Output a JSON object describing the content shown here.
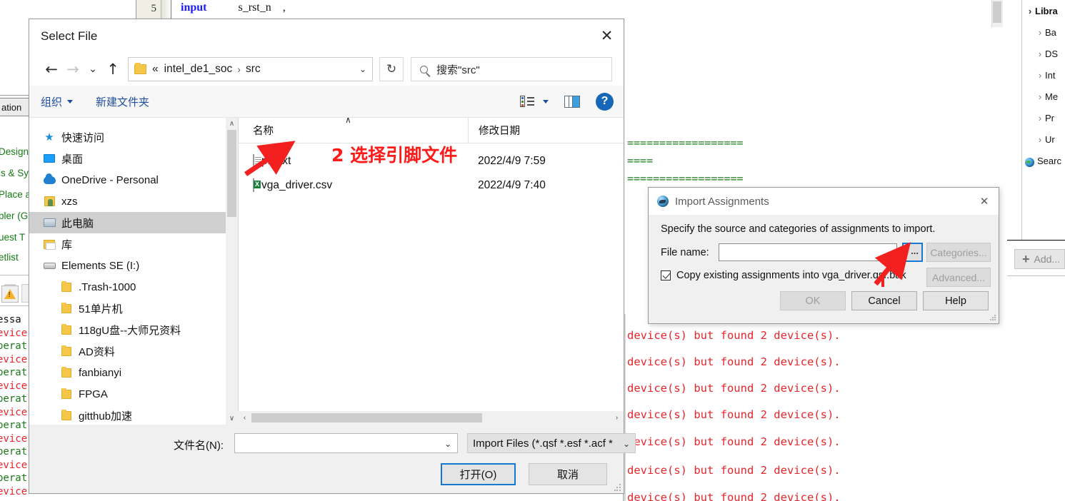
{
  "background": {
    "code_line": {
      "number": "5",
      "keyword": "input",
      "identifier": "s_rst_n",
      "comma": ","
    },
    "right_tree": {
      "root": "Libra",
      "items": [
        "Ba",
        "DS",
        "Int",
        "Me",
        "Pr",
        "Ur"
      ],
      "search_item": "Searc"
    },
    "add_button": "Add...",
    "green_lines": [
      "==================",
      "====",
      "=================="
    ],
    "error_line": "device(s) but found 2 device(s).",
    "error_lines_count": 7,
    "left_strip": {
      "tab_label": "ation",
      "green_rows": [
        "Design",
        "is & Sy",
        "Place a",
        "bler (G",
        "uest T",
        "etlist "
      ],
      "message_rows": [
        {
          "text": "essa",
          "color": "#111111"
        },
        {
          "text": "evice",
          "color": "#e8252b"
        },
        {
          "text": "perat",
          "color": "#1a7a1a"
        },
        {
          "text": "evice",
          "color": "#e8252b"
        },
        {
          "text": "perat",
          "color": "#1a7a1a"
        },
        {
          "text": "evice",
          "color": "#e8252b"
        },
        {
          "text": "perat",
          "color": "#1a7a1a"
        },
        {
          "text": "evice",
          "color": "#e8252b"
        },
        {
          "text": "perat",
          "color": "#1a7a1a"
        },
        {
          "text": "evice",
          "color": "#e8252b"
        },
        {
          "text": "perat",
          "color": "#1a7a1a"
        },
        {
          "text": "evice",
          "color": "#e8252b"
        },
        {
          "text": "perat",
          "color": "#1a7a1a"
        },
        {
          "text": "evice",
          "color": "#e8252b"
        }
      ]
    }
  },
  "select_file_dialog": {
    "title": "Select File",
    "close_label": "✕",
    "nav": {
      "back": "←",
      "forward": "→",
      "recent": "⌄",
      "up": "↑",
      "breadcrumb_prefix": "«",
      "breadcrumb_parts": [
        "intel_de1_soc",
        "src"
      ],
      "breadcrumb_sep": "›",
      "breadcrumb_chevron": "⌄",
      "refresh": "↻"
    },
    "search": {
      "placeholder": "搜索\"src\"",
      "icon": "search-icon"
    },
    "commandbar": {
      "organize": "组织",
      "new_folder": "新建文件夹",
      "view_icon": "view-list-icon",
      "view_chevron": "▼",
      "preview_icon": "preview-pane-icon",
      "help_icon": "?"
    },
    "sidebar": {
      "items": [
        {
          "label": "快速访问",
          "icon": "star-icon",
          "indent": false,
          "selected": false
        },
        {
          "label": "桌面",
          "icon": "desktop-icon",
          "indent": false,
          "selected": false
        },
        {
          "label": "OneDrive - Personal",
          "icon": "cloud-icon",
          "indent": false,
          "selected": false
        },
        {
          "label": "xzs",
          "icon": "user-folder-icon",
          "indent": false,
          "selected": false
        },
        {
          "label": "此电脑",
          "icon": "this-pc-icon",
          "indent": false,
          "selected": true
        },
        {
          "label": "库",
          "icon": "library-icon",
          "indent": false,
          "selected": false
        },
        {
          "label": "Elements SE (I:)",
          "icon": "drive-icon",
          "indent": false,
          "selected": false
        },
        {
          "label": ".Trash-1000",
          "icon": "folder-icon",
          "indent": true,
          "selected": false
        },
        {
          "label": "51单片机",
          "icon": "folder-icon",
          "indent": true,
          "selected": false
        },
        {
          "label": "118gU盘--大师兄资料",
          "icon": "folder-icon",
          "indent": true,
          "selected": false
        },
        {
          "label": "AD资料",
          "icon": "folder-icon",
          "indent": true,
          "selected": false
        },
        {
          "label": "fanbianyi",
          "icon": "folder-icon",
          "indent": true,
          "selected": false
        },
        {
          "label": "FPGA",
          "icon": "folder-icon",
          "indent": true,
          "selected": false
        },
        {
          "label": "gitthub加速",
          "icon": "folder-icon",
          "indent": true,
          "selected": false
        }
      ],
      "scroll_up": "∧",
      "scroll_down": "∨"
    },
    "filelist": {
      "columns": [
        "名称",
        "修改日期"
      ],
      "sort_indicator": "∧",
      "rows": [
        {
          "name": "pin.txt",
          "icon": "text-file-icon",
          "date": "2022/4/9 7:59"
        },
        {
          "name": "vga_driver.csv",
          "icon": "csv-file-icon",
          "date": "2022/4/9 7:40"
        }
      ],
      "hscroll_left": "‹",
      "hscroll_right": "›"
    },
    "footer": {
      "filename_label": "文件名(N):",
      "filename_value": "",
      "filename_chevron": "⌄",
      "filetype_value": "Import Files (*.qsf *.esf *.acf *",
      "filetype_chevron": "⌄",
      "open_button": "打开(O)",
      "cancel_button": "取消"
    }
  },
  "import_assignments_dialog": {
    "title": "Import Assignments",
    "icon": "quartus-globe-icon",
    "close_label": "✕",
    "description": "Specify the source and categories of assignments to import.",
    "filename_label": "File name:",
    "filename_value": "",
    "browse_button": "...",
    "categories_button": "Categories...",
    "checkbox": {
      "checked": true,
      "label": "Copy existing assignments into vga_driver.qsf.bak"
    },
    "advanced_button": "Advanced...",
    "ok_button": "OK",
    "cancel_button": "Cancel",
    "help_button": "Help"
  },
  "annotations": [
    {
      "id": "step-2",
      "text": "2 选择引脚文件",
      "color": "#ff1a1a"
    }
  ]
}
